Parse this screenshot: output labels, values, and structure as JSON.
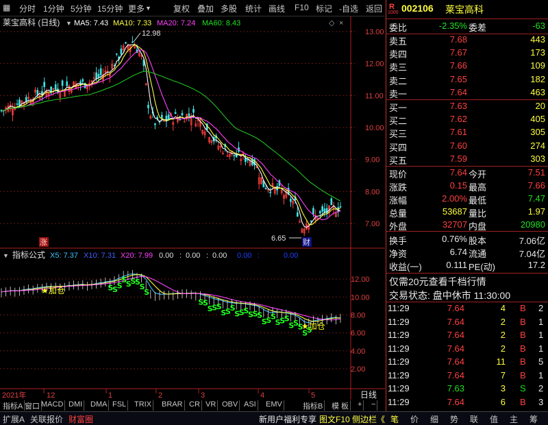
{
  "toolbar": {
    "left": [
      "分时",
      "1分钟",
      "5分钟",
      "15分钟",
      "更多",
      "复权",
      "叠加",
      "多股",
      "统计",
      "画线",
      "F10",
      "标记",
      "-自选",
      "返回"
    ]
  },
  "stock": {
    "code": "002106",
    "name": "莱宝高科",
    "title": "莱宝高科 (日线)",
    "exchange_badge": "R",
    "exchange_sub": "1000"
  },
  "ma_legend": {
    "ma5": "MA5: 7.43",
    "ma10": "MA10: 7.33",
    "ma20": "MA20: 7.24",
    "ma60": "MA60: 8.43"
  },
  "price_axis": [
    "13.00",
    "12.00",
    "11.00",
    "10.00",
    "9.00",
    "8.00",
    "7.00"
  ],
  "high_label": "12.98",
  "low_label": "6.65",
  "zhang_badge": "涨",
  "cai_badge": "财",
  "indicator": {
    "name": "指标公式",
    "x5": "X5: 7.37",
    "x10": "X10: 7.31",
    "x20": "X20: 7.99",
    "zeros": [
      "0.00",
      "0.00",
      "0.00",
      "0.00",
      "0.00"
    ],
    "axis": [
      "12.00",
      "10.00",
      "8.00",
      "6.00",
      "4.00",
      "2.00"
    ],
    "jiacang1": "★加仓",
    "jiacang2": "★加仓"
  },
  "date_axis": {
    "year": "2021年",
    "months": [
      "12",
      "1",
      "2",
      "3",
      "4",
      "5"
    ],
    "period": "日线"
  },
  "tabs": [
    "指标A",
    "窗口",
    "MACD",
    "DMI",
    "DMA",
    "FSL",
    "TRIX",
    "BRAR",
    "CR",
    "VR",
    "OBV",
    "ASI",
    "EMV",
    "指标B",
    "模 板",
    "+",
    "−"
  ],
  "bottom": {
    "items": [
      "扩展A",
      "关联报价",
      "财富圈"
    ],
    "ad": "新用户福利专享",
    "f10": "图文F10",
    "side": "侧边栏《",
    "right_tabs": [
      "笔",
      "价",
      "细",
      "势",
      "联",
      "值",
      "主",
      "筹"
    ]
  },
  "weibi": {
    "label": "委比",
    "value": "-2.35%",
    "label2": "委差",
    "value2": "-63"
  },
  "asks": [
    [
      "卖五",
      "7.68",
      "443"
    ],
    [
      "卖四",
      "7.67",
      "173"
    ],
    [
      "卖三",
      "7.66",
      "109"
    ],
    [
      "卖二",
      "7.65",
      "182"
    ],
    [
      "卖一",
      "7.64",
      "463"
    ]
  ],
  "bids": [
    [
      "买一",
      "7.63",
      "20"
    ],
    [
      "买二",
      "7.62",
      "405"
    ],
    [
      "买三",
      "7.61",
      "305"
    ],
    [
      "买四",
      "7.60",
      "274"
    ],
    [
      "买五",
      "7.59",
      "303"
    ]
  ],
  "quote": [
    [
      "现价",
      "7.64",
      "今开",
      "7.51"
    ],
    [
      "涨跌",
      "0.15",
      "最高",
      "7.66"
    ],
    [
      "涨幅",
      "2.00%",
      "最低",
      "7.47"
    ],
    [
      "总量",
      "53687",
      "量比",
      "1.97"
    ],
    [
      "外盘",
      "32707",
      "内盘",
      "20980"
    ],
    [
      "换手",
      "0.76%",
      "股本",
      "7.06亿"
    ],
    [
      "净资",
      "6.74",
      "流通",
      "7.04亿"
    ],
    [
      "收益(一)",
      "0.111",
      "PE(动)",
      "17.2"
    ]
  ],
  "promo": "仅需20元查看千档行情",
  "status": "交易状态: 盘中休市 11:30:00",
  "ticks": [
    [
      "11:29",
      "7.64",
      "4",
      "B",
      "2"
    ],
    [
      "11:29",
      "7.64",
      "2",
      "B",
      "1"
    ],
    [
      "11:29",
      "7.64",
      "2",
      "B",
      "1"
    ],
    [
      "11:29",
      "7.64",
      "2",
      "B",
      "1"
    ],
    [
      "11:29",
      "7.64",
      "11",
      "B",
      "5"
    ],
    [
      "11:29",
      "7.64",
      "7",
      "B",
      "1"
    ],
    [
      "11:29",
      "7.63",
      "3",
      "S",
      "2"
    ],
    [
      "11:29",
      "7.64",
      "6",
      "B",
      "3"
    ]
  ],
  "colors": {
    "up": "#ff4040",
    "down": "#20e020",
    "ma5": "#ffffff",
    "ma10": "#ffff40",
    "ma20": "#ff40ff",
    "ma60": "#20c020"
  }
}
